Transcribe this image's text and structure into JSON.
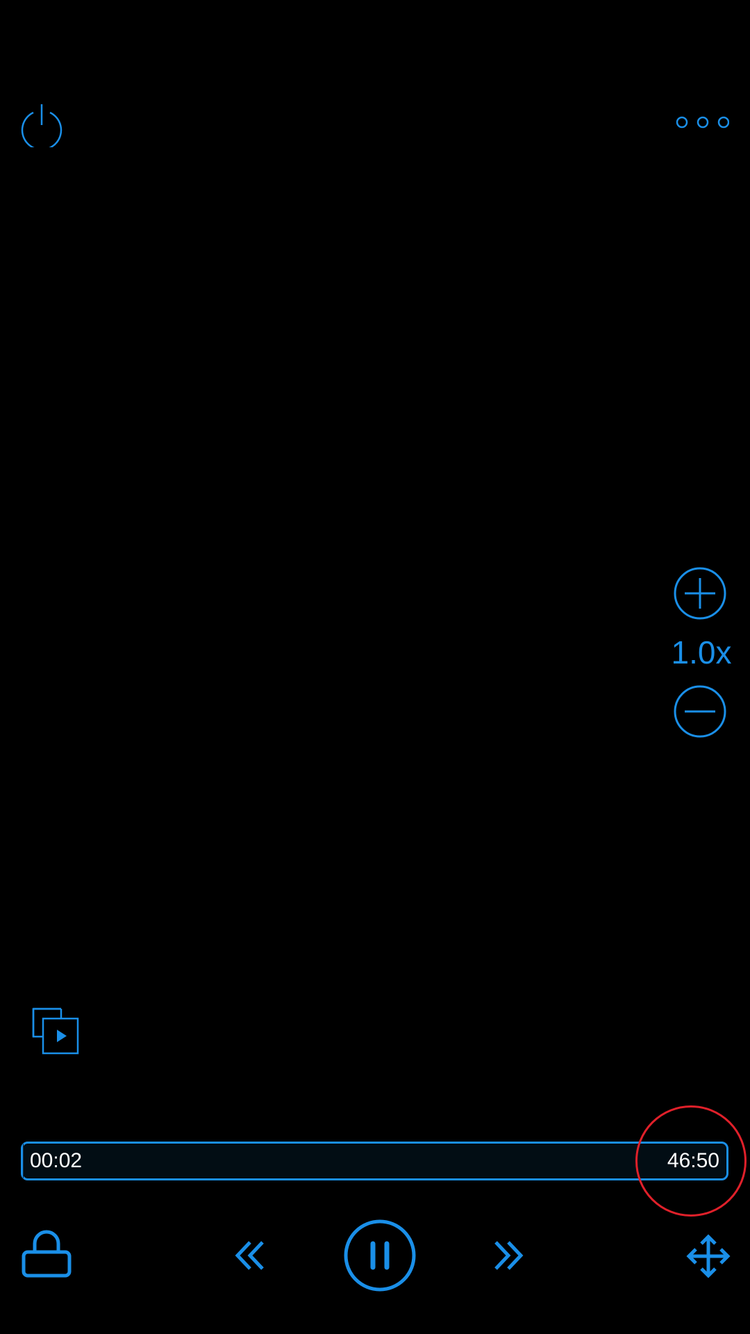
{
  "player": {
    "speed_label": "1.0x",
    "current_time": "00:02",
    "total_time": "46:50",
    "progress_fraction": 0.0007
  },
  "icons": {
    "power": "power-icon",
    "more": "more-options-icon",
    "zoom_in": "zoom-in-icon",
    "zoom_out": "zoom-out-icon",
    "pip": "picture-in-picture-icon",
    "lock": "lock-icon",
    "rewind": "rewind-icon",
    "pause": "pause-icon",
    "forward": "fast-forward-icon",
    "move": "move-icon"
  },
  "colors": {
    "accent": "#1a8fe8",
    "background": "#000000",
    "annotation": "#e0202a",
    "text": "#ffffff"
  }
}
